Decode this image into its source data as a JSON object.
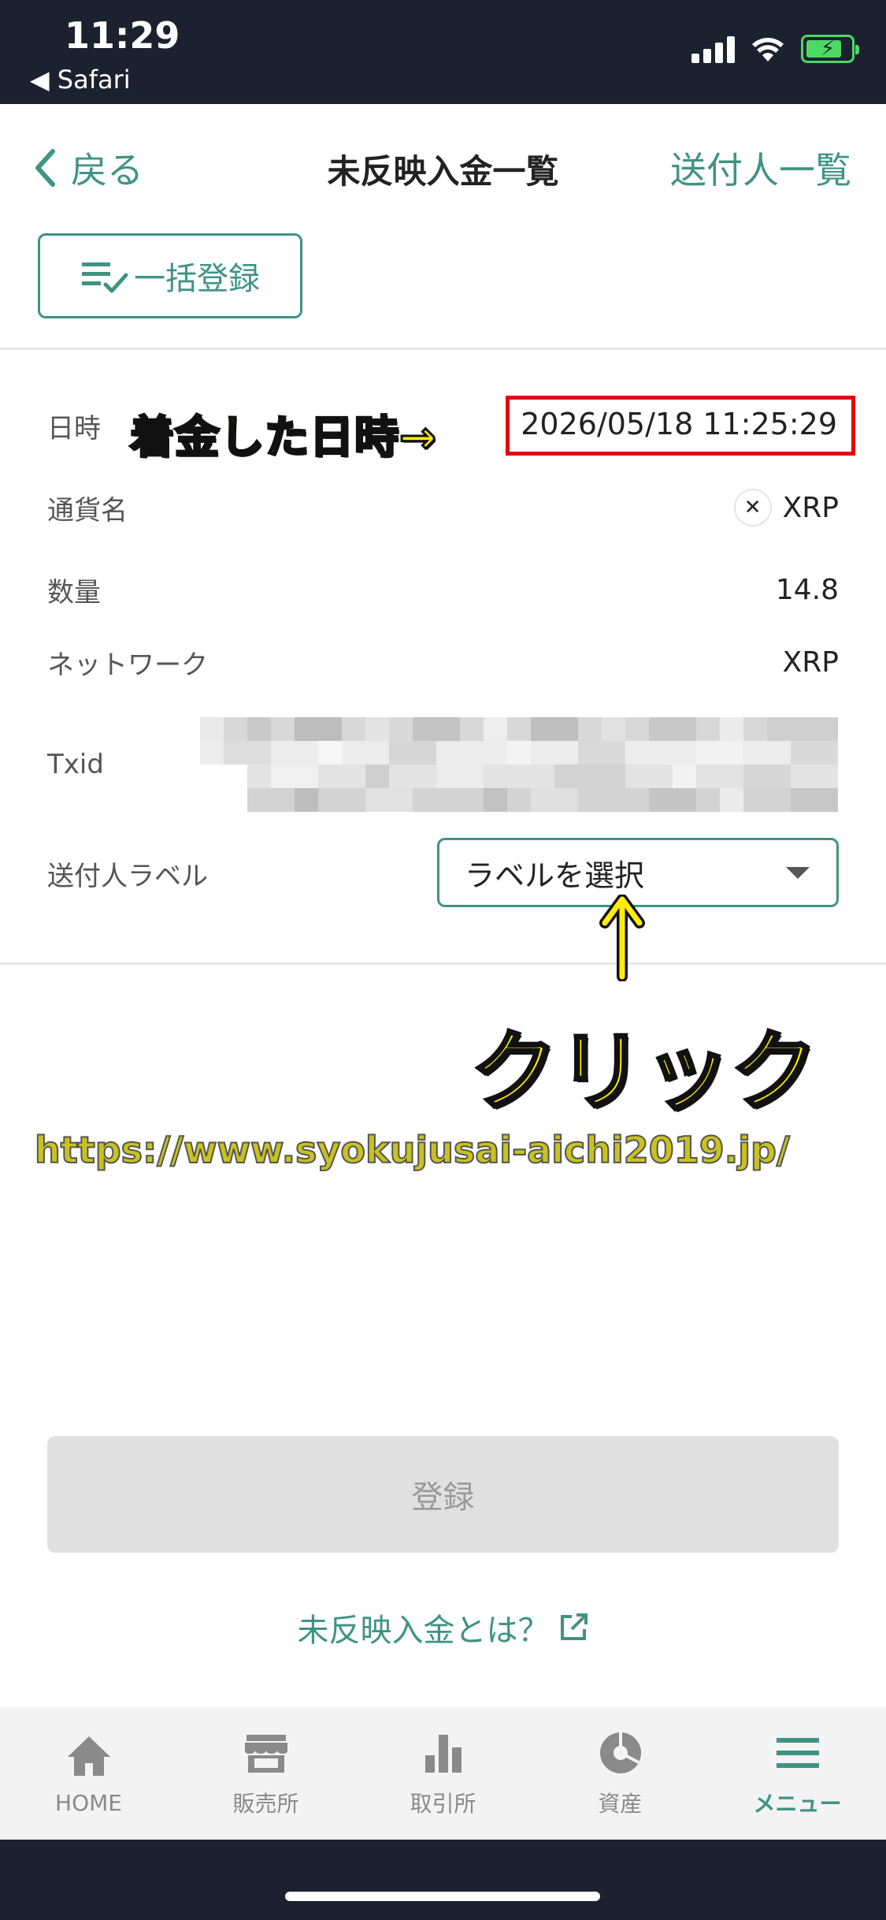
{
  "status_bar": {
    "time": "11:29",
    "back_app": "◀ Safari"
  },
  "nav": {
    "back_label": "戻る",
    "title": "未反映入金一覧",
    "right_link": "送付人一覧"
  },
  "bulk_button": {
    "label": "一括登録"
  },
  "details": {
    "datetime": {
      "label": "日時",
      "value": "2026/05/18 11:25:29"
    },
    "currency": {
      "label": "通貨名",
      "value": "XRP"
    },
    "amount": {
      "label": "数量",
      "value": "14.8"
    },
    "network": {
      "label": "ネットワーク",
      "value": "XRP"
    },
    "txid": {
      "label": "Txid"
    },
    "sender_label": {
      "label": "送付人ラベル",
      "placeholder": "ラベルを選択"
    }
  },
  "annotations": {
    "arrival": "着金した日時→",
    "click": "クリック",
    "watermark": "https://www.syokujusai-aichi2019.jp/"
  },
  "register_button": {
    "label": "登録"
  },
  "help_link": {
    "label": "未反映入金とは？"
  },
  "tabs": [
    {
      "label": "HOME",
      "icon": "home-icon"
    },
    {
      "label": "販売所",
      "icon": "store-icon"
    },
    {
      "label": "取引所",
      "icon": "bar-chart-icon"
    },
    {
      "label": "資産",
      "icon": "pie-chart-icon"
    },
    {
      "label": "メニュー",
      "icon": "menu-icon",
      "active": true
    }
  ],
  "colors": {
    "accent": "#3f9384",
    "annotation_yellow": "#ffee00",
    "highlight_red": "#e60012",
    "dark_bar": "#1c2130"
  }
}
